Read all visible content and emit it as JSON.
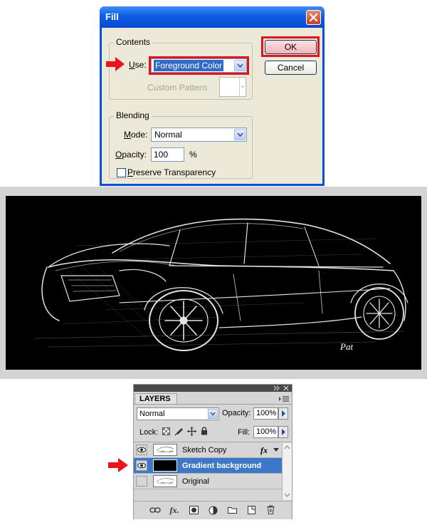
{
  "fill_dialog": {
    "title": "Fill",
    "contents": {
      "legend": "Contents",
      "use_label_pre": "U",
      "use_label_post": "se:",
      "use_value": "Foreground Color",
      "custom_pattern_label": "Custom Pattern:"
    },
    "blending": {
      "legend": "Blending",
      "mode_label_pre": "M",
      "mode_label_post": "ode:",
      "mode_value": "Normal",
      "opacity_label_pre": "O",
      "opacity_label_post": "pacity:",
      "opacity_value": "100",
      "opacity_unit": "%",
      "preserve_pre": "P",
      "preserve_post": "reserve Transparency",
      "preserve_checked": false
    },
    "ok_label": "OK",
    "cancel_label": "Cancel",
    "colors": {
      "highlight": "#e0141e",
      "titlebar": "#0f5de3"
    }
  },
  "layers_panel": {
    "tab_label": "LAYERS",
    "blend_mode": "Normal",
    "opacity_label": "Opacity:",
    "opacity_value": "100%",
    "lock_label": "Lock:",
    "fill_label": "Fill:",
    "fill_value": "100%",
    "layers": [
      {
        "name": "Sketch Copy",
        "visible": true,
        "selected": false,
        "fx": "fx"
      },
      {
        "name": "Gradient background",
        "visible": true,
        "selected": true
      },
      {
        "name": "Original",
        "visible": false,
        "selected": false
      }
    ],
    "bottom_icons": [
      "link-icon",
      "fx-icon",
      "mask-icon",
      "adjustment-icon",
      "group-folder-icon",
      "new-layer-icon",
      "trash-icon"
    ]
  },
  "sketch": {
    "signature": "Pat"
  }
}
